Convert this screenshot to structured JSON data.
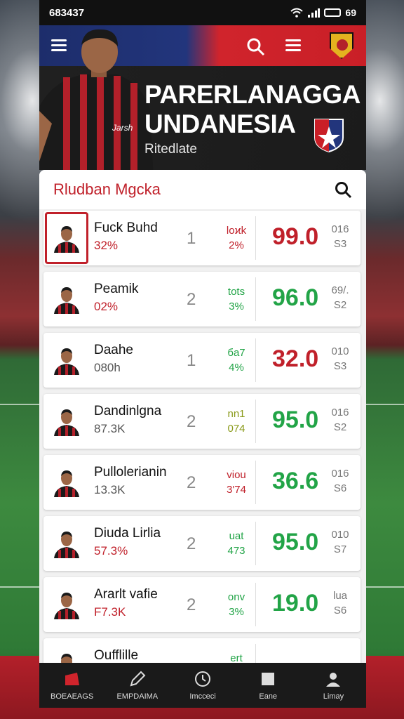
{
  "status_bar": {
    "time": "683437",
    "right_text": "69"
  },
  "header": {
    "title": "PARERLANAGGA UNDANESIA",
    "subtitle": "Ritedlate",
    "colors": {
      "blue": "#22357c",
      "red": "#c91f27",
      "dark": "#1b1b1b"
    }
  },
  "list": {
    "title": "Rludban Mgcka",
    "rows": [
      {
        "name": "Fuck Buhd",
        "sub": "32%",
        "sub_color": "red",
        "rank": "1",
        "chg1": "loϰk",
        "chg2": "2%",
        "chg_color": "red",
        "score": "99.0",
        "score_color": "red",
        "mini1": "016",
        "mini2": "S3",
        "selected": true
      },
      {
        "name": "Peamik",
        "sub": "02%",
        "sub_color": "red",
        "rank": "2",
        "chg1": "tots",
        "chg2": "3%",
        "chg_color": "green",
        "score": "96.0",
        "score_color": "green",
        "mini1": "69/.",
        "mini2": "S2",
        "selected": false
      },
      {
        "name": "Daahe",
        "sub": "080h",
        "sub_color": "gray",
        "rank": "1",
        "chg1": "бa7",
        "chg2": "4%",
        "chg_color": "green",
        "score": "32.0",
        "score_color": "red",
        "mini1": "010",
        "mini2": "S3",
        "selected": false
      },
      {
        "name": "Dandinlgna",
        "sub": "87.3K",
        "sub_color": "gray",
        "rank": "2",
        "chg1": "nn1",
        "chg2": "074",
        "chg_color": "olive",
        "score": "95.0",
        "score_color": "green",
        "mini1": "016",
        "mini2": "S2",
        "selected": false
      },
      {
        "name": "Pullolerianin",
        "sub": "13.3K",
        "sub_color": "gray",
        "rank": "2",
        "chg1": "viou",
        "chg2": "3'74",
        "chg_color": "red",
        "score": "36.6",
        "score_color": "green",
        "mini1": "016",
        "mini2": "S6",
        "selected": false
      },
      {
        "name": "Diuda Lirlia",
        "sub": "57.3%",
        "sub_color": "red",
        "rank": "2",
        "chg1": "uat",
        "chg2": "473",
        "chg_color": "green",
        "score": "95.0",
        "score_color": "green",
        "mini1": "010",
        "mini2": "S7",
        "selected": false
      },
      {
        "name": "Ararlt vafie",
        "sub": "F7.3K",
        "sub_color": "red",
        "rank": "2",
        "chg1": "onv",
        "chg2": "3%",
        "chg_color": "green",
        "score": "19.0",
        "score_color": "green",
        "mini1": "lua",
        "mini2": "S6",
        "selected": false
      },
      {
        "name": "Oufflille",
        "sub": "",
        "sub_color": "gray",
        "rank": "",
        "chg1": "ert",
        "chg2": "",
        "chg_color": "green",
        "score": "",
        "score_color": "green",
        "mini1": "",
        "mini2": "",
        "selected": false
      }
    ]
  },
  "nav": [
    {
      "label": "BOEAEAGS",
      "icon": "home-icon"
    },
    {
      "label": "EMPDAIMA",
      "icon": "edit-icon"
    },
    {
      "label": "Imcceci",
      "icon": "clock-icon"
    },
    {
      "label": "Eane",
      "icon": "square-icon"
    },
    {
      "label": "Limay",
      "icon": "profile-icon"
    }
  ]
}
